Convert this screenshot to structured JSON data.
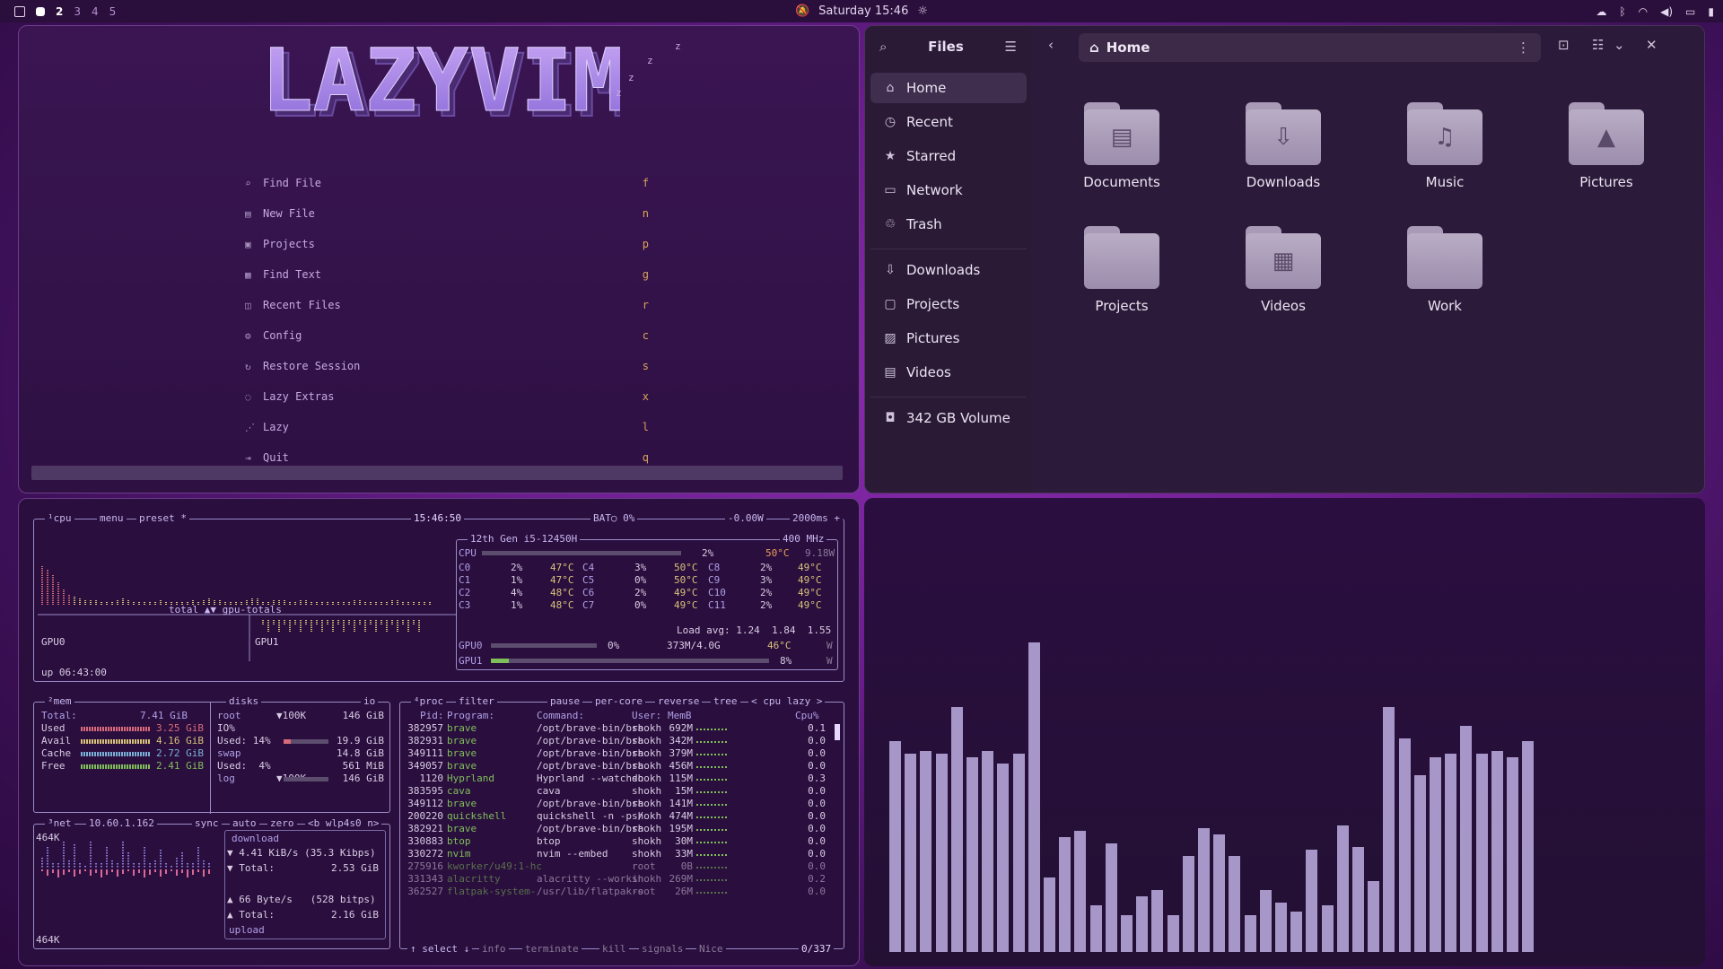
{
  "topbar": {
    "workspaces": [
      "2",
      "3",
      "4",
      "5"
    ],
    "active_workspace": "2",
    "clock": "Saturday 15:46"
  },
  "lazyvim": {
    "logo_text": "LAZYVIM",
    "zzz": [
      "z",
      "z",
      "z",
      "z"
    ],
    "items": [
      {
        "icon": "search-icon",
        "glyph": "⌕",
        "label": "Find File",
        "key": "f"
      },
      {
        "icon": "file-icon",
        "glyph": "▤",
        "label": "New File",
        "key": "n"
      },
      {
        "icon": "projects-icon",
        "glyph": "▣",
        "label": "Projects",
        "key": "p"
      },
      {
        "icon": "find-text-icon",
        "glyph": "▦",
        "label": "Find Text",
        "key": "g"
      },
      {
        "icon": "recent-files-icon",
        "glyph": "◫",
        "label": "Recent Files",
        "key": "r"
      },
      {
        "icon": "gear-icon",
        "glyph": "⚙",
        "label": "Config",
        "key": "c"
      },
      {
        "icon": "restore-icon",
        "glyph": "↻",
        "label": "Restore Session",
        "key": "s"
      },
      {
        "icon": "extras-icon",
        "glyph": "◌",
        "label": "Lazy Extras",
        "key": "x"
      },
      {
        "icon": "lazy-icon",
        "glyph": "⋰",
        "label": "Lazy",
        "key": "l"
      },
      {
        "icon": "quit-icon",
        "glyph": "⇥",
        "label": "Quit",
        "key": "q"
      }
    ]
  },
  "files": {
    "title": "Files",
    "path": "Home",
    "sidebar": [
      {
        "icon": "home-icon",
        "glyph": "⌂",
        "label": "Home",
        "active": true
      },
      {
        "icon": "recent-icon",
        "glyph": "◷",
        "label": "Recent"
      },
      {
        "icon": "star-icon",
        "glyph": "★",
        "label": "Starred"
      },
      {
        "icon": "network-icon",
        "glyph": "▭",
        "label": "Network"
      },
      {
        "icon": "trash-icon",
        "glyph": "♲",
        "label": "Trash"
      },
      {
        "icon": "downloads-icon",
        "glyph": "⇩",
        "label": "Downloads"
      },
      {
        "icon": "folder-icon",
        "glyph": "▢",
        "label": "Projects"
      },
      {
        "icon": "pictures-icon",
        "glyph": "▨",
        "label": "Pictures"
      },
      {
        "icon": "videos-icon",
        "glyph": "▤",
        "label": "Videos"
      },
      {
        "icon": "drive-icon",
        "glyph": "◘",
        "label": "342 GB Volume"
      }
    ],
    "folders": [
      {
        "name": "Documents",
        "emblem": "document-icon",
        "glyph": "▤"
      },
      {
        "name": "Downloads",
        "emblem": "download-icon",
        "glyph": "⇩"
      },
      {
        "name": "Music",
        "emblem": "music-icon",
        "glyph": "♫"
      },
      {
        "name": "Pictures",
        "emblem": "picture-icon",
        "glyph": "▲"
      },
      {
        "name": "Projects",
        "emblem": "",
        "glyph": ""
      },
      {
        "name": "Videos",
        "emblem": "film-icon",
        "glyph": "▦"
      },
      {
        "name": "Work",
        "emblem": "",
        "glyph": ""
      }
    ]
  },
  "btop": {
    "cpu_box": {
      "title_num": "¹cpu",
      "menu": "menu",
      "preset": "preset *",
      "time": "15:46:50",
      "bat": "BAT○ 0%",
      "power": "-0.00W",
      "rate": "2000ms +",
      "graph_label": "total ▲▼ gpu-totals",
      "gpu0": "GPU0",
      "gpu1": "GPU1",
      "uptime": "up 06:43:00",
      "model": "12th Gen i5-12450H",
      "freq": "400 MHz",
      "cpu_line": {
        "label": "CPU",
        "pct": "2%",
        "temp": "50°C",
        "watt": "9.18W"
      },
      "cores": [
        [
          "C0",
          "2%",
          "47°C",
          "C4",
          "3%",
          "50°C",
          "C8",
          "2%",
          "49°C"
        ],
        [
          "C1",
          "1%",
          "47°C",
          "C5",
          "0%",
          "50°C",
          "C9",
          "3%",
          "49°C"
        ],
        [
          "C2",
          "4%",
          "48°C",
          "C6",
          "2%",
          "49°C",
          "C10",
          "2%",
          "49°C"
        ],
        [
          "C3",
          "1%",
          "48°C",
          "C7",
          "0%",
          "49°C",
          "C11",
          "2%",
          "49°C"
        ]
      ],
      "load_avg": "Load avg: 1.24  1.84  1.55",
      "gpu0_line": {
        "label": "GPU0",
        "pct": "0%",
        "mem": "373M/4.0G",
        "temp": "46°C",
        "watt": "W"
      },
      "gpu1_line": {
        "label": "GPU1",
        "pct": "8%",
        "watt": "W"
      }
    },
    "mem_box": {
      "title": "²mem",
      "disks": "disks",
      "io": "io",
      "total": {
        "label": "Total:",
        "value": "7.41 GiB"
      },
      "rows": [
        {
          "label": "Used",
          "value": "3.25 GiB",
          "color": "#d86a7a"
        },
        {
          "label": "Avail",
          "value": "4.16 GiB",
          "color": "#d8c27a"
        },
        {
          "label": "Cache",
          "value": "2.72 GiB",
          "color": "#7ab0d8"
        },
        {
          "label": "Free",
          "value": "2.41 GiB",
          "color": "#7fbf5a"
        }
      ],
      "disk_rows": [
        {
          "a": "root",
          "b": "▼100K",
          "c": "146 GiB"
        },
        {
          "a": "IO%",
          "b": "",
          "c": ""
        },
        {
          "a": "Used: 14%",
          "b": "",
          "c": "19.9 GiB"
        },
        {
          "a": "swap",
          "b": "",
          "c": "14.8 GiB"
        },
        {
          "a": "Used:  4%",
          "b": "",
          "c": "561 MiB"
        },
        {
          "a": "log",
          "b": "▼100K",
          "c": "146 GiB"
        }
      ]
    },
    "net_box": {
      "title": "³net",
      "ip": "10.60.1.162",
      "sync": "sync",
      "auto": "auto",
      "zero": "zero",
      "iface": "<b wlp4s0 n>",
      "scale_top": "464K",
      "scale_bottom": "464K",
      "download": "download",
      "dl_rate": "▼ 4.41 KiB/s (35.3 Kibps)",
      "dl_total": "▼ Total:",
      "dl_total_v": "2.53 GiB",
      "ul_rate": "▲ 66 Byte/s   (528 bitps)",
      "ul_total": "▲ Total:",
      "ul_total_v": "2.16 GiB",
      "upload": "upload"
    },
    "proc_box": {
      "title": "⁴proc",
      "filter": "filter",
      "pause": "pause",
      "per_core": "per-core",
      "reverse": "reverse",
      "tree": "tree",
      "sort": "< cpu lazy >",
      "headers": [
        "Pid:",
        "Program:",
        "Command:",
        "User:",
        "MemB",
        "Cpu%"
      ],
      "rows": [
        [
          "382957",
          "brave",
          "/opt/brave-bin/bra",
          "shokh",
          "692M",
          "0.1"
        ],
        [
          "382931",
          "brave",
          "/opt/brave-bin/bra",
          "shokh",
          "342M",
          "0.0"
        ],
        [
          "349111",
          "brave",
          "/opt/brave-bin/bra",
          "shokh",
          "379M",
          "0.0"
        ],
        [
          "349057",
          "brave",
          "/opt/brave-bin/bra",
          "shokh",
          "456M",
          "0.0"
        ],
        [
          "1120",
          "Hyprland",
          "Hyprland --watchdo",
          "shokh",
          "115M",
          "0.3"
        ],
        [
          "383595",
          "cava",
          "cava",
          "shokh",
          "15M",
          "0.0"
        ],
        [
          "349112",
          "brave",
          "/opt/brave-bin/bra",
          "shokh",
          "141M",
          "0.0"
        ],
        [
          "200220",
          "quickshell",
          "quickshell -n -p /",
          "shokh",
          "474M",
          "0.0"
        ],
        [
          "382921",
          "brave",
          "/opt/brave-bin/bra",
          "shokh",
          "195M",
          "0.0"
        ],
        [
          "330883",
          "btop",
          "btop",
          "shokh",
          "30M",
          "0.0"
        ],
        [
          "330272",
          "nvim",
          "nvim --embed",
          "shokh",
          "33M",
          "0.0"
        ],
        [
          "275916",
          "kworker/u49:1-hc",
          "",
          "root",
          "0B",
          "0.0"
        ],
        [
          "331343",
          "alacritty",
          "alacritty --workin",
          "shokh",
          "269M",
          "0.2"
        ],
        [
          "362527",
          "flatpak-system-",
          "/usr/lib/flatpak-s",
          "root",
          "26M",
          "0.0"
        ]
      ],
      "footer": "↑ select ↓",
      "footer_items": [
        "info",
        "terminate",
        "kill",
        "signals",
        "Nice"
      ],
      "count": "0/337"
    }
  },
  "cava": {
    "levels": [
      0.68,
      0.64,
      0.65,
      0.64,
      0.79,
      0.63,
      0.65,
      0.61,
      0.64,
      1.0,
      0.24,
      0.37,
      0.39,
      0.15,
      0.35,
      0.12,
      0.18,
      0.2,
      0.12,
      0.31,
      0.4,
      0.38,
      0.31,
      0.12,
      0.2,
      0.16,
      0.13,
      0.33,
      0.15,
      0.41,
      0.34,
      0.23,
      0.79,
      0.69,
      0.57,
      0.63,
      0.64,
      0.73,
      0.64,
      0.65,
      0.63,
      0.68
    ]
  },
  "colors": {
    "accent": "#b48fcf",
    "cava_bar": "#a796c8",
    "btop_frame": "#9a8cc8"
  }
}
